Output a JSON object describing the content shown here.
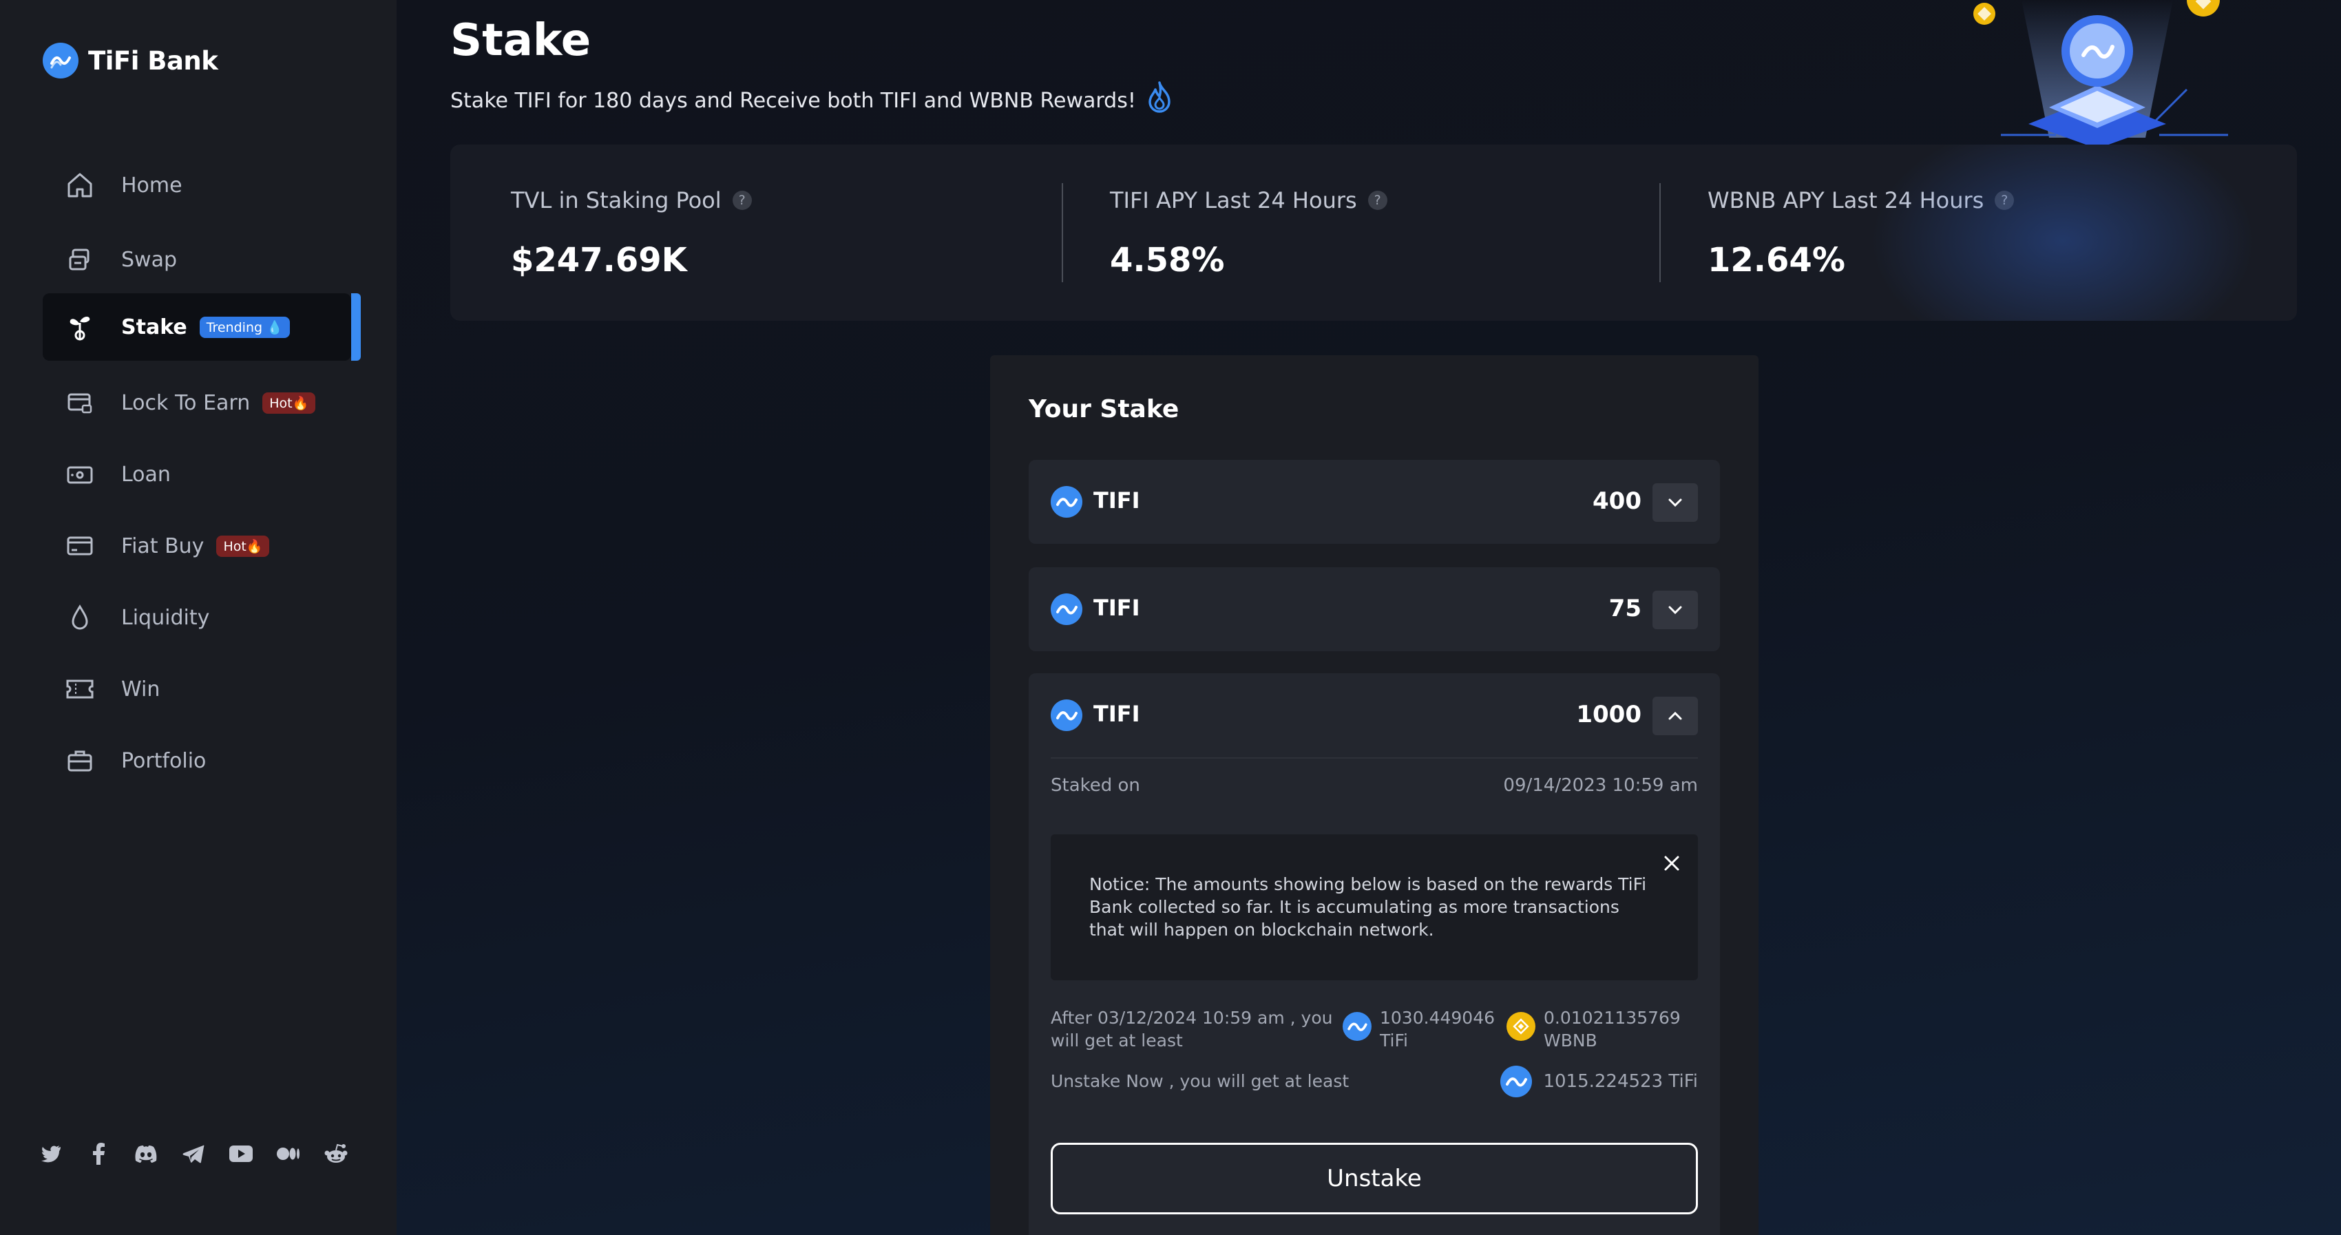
{
  "brand": {
    "name": "TiFi Bank"
  },
  "sidebar": {
    "items": [
      {
        "label": "Home",
        "badge": ""
      },
      {
        "label": "Swap",
        "badge": ""
      },
      {
        "label": "Stake",
        "badge": "Trending"
      },
      {
        "label": "Lock To Earn",
        "badge": "Hot"
      },
      {
        "label": "Loan",
        "badge": ""
      },
      {
        "label": "Fiat Buy",
        "badge": "Hot"
      },
      {
        "label": "Liquidity",
        "badge": ""
      },
      {
        "label": "Win",
        "badge": ""
      },
      {
        "label": "Portfolio",
        "badge": ""
      }
    ],
    "active_item": "Stake",
    "socials": [
      "twitter-icon",
      "facebook-icon",
      "discord-icon",
      "telegram-icon",
      "youtube-icon",
      "medium-icon",
      "reddit-icon"
    ]
  },
  "header": {
    "title": "Stake",
    "subtitle": "Stake TIFI for 180 days and Receive both TIFI and WBNB Rewards!"
  },
  "stats": [
    {
      "label": "TVL in Staking Pool",
      "value": "$247.69K"
    },
    {
      "label": "TIFI APY Last 24 Hours",
      "value": "4.58%"
    },
    {
      "label": "WBNB APY Last 24 Hours",
      "value": "12.64%"
    }
  ],
  "your_stake": {
    "title": "Your Stake",
    "rows": [
      {
        "token": "TIFI",
        "amount": "400",
        "expanded": false
      },
      {
        "token": "TIFI",
        "amount": "75",
        "expanded": false
      },
      {
        "token": "TIFI",
        "amount": "1000",
        "expanded": true
      }
    ],
    "details": {
      "staked_on_label": "Staked on",
      "staked_on_value": "09/14/2023 10:59 am",
      "notice": "Notice: The amounts showing below is based on the rewards TiFi Bank collected so far. It is accumulating as more transactions that will happen on blockchain network.",
      "after_label": "After 03/12/2024 10:59 am , you will get at least",
      "after_tifi": "1030.449046 TiFi",
      "after_wbnb": "0.01021135769 WBNB",
      "unstake_now_label": "Unstake Now , you will get at least",
      "unstake_now_value": "1015.224523 TiFi",
      "unstake_button": "Unstake"
    }
  },
  "colors": {
    "accent": "#3a8cf2",
    "sidebar_bg": "#1a1c22",
    "card_bg": "#1b1d23",
    "row_bg": "#23262e",
    "hot_badge": "#7a2222",
    "wbnb": "#f0b90b"
  }
}
